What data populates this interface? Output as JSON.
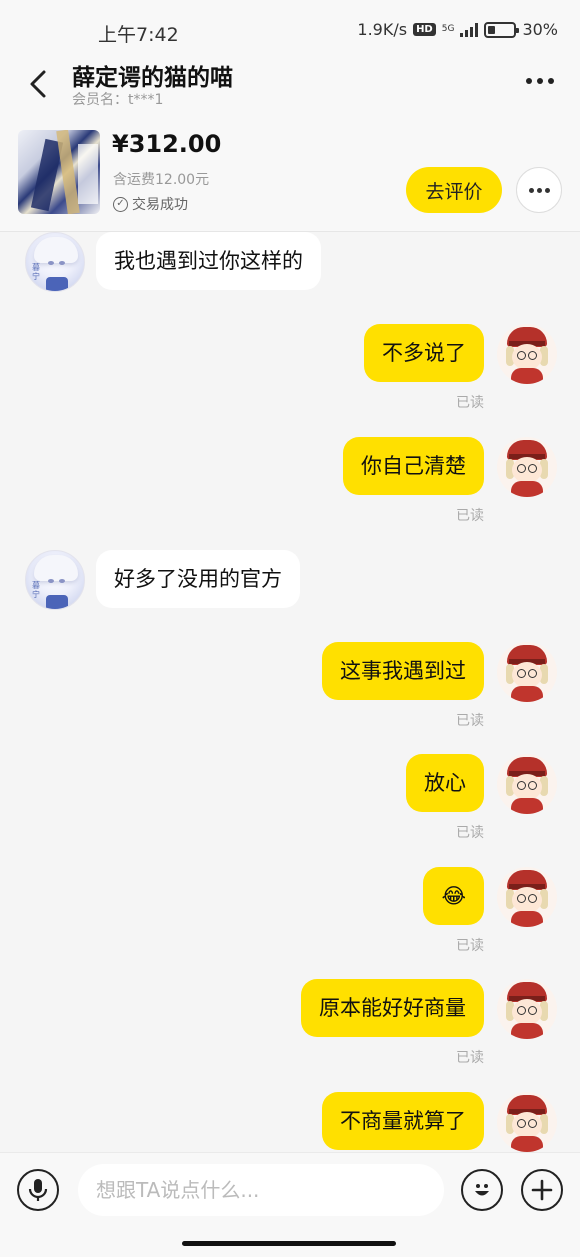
{
  "status_bar": {
    "time": "上午7:42",
    "net_speed": "1.9K/s",
    "hd": "HD",
    "network": "5G",
    "battery_label": "30%",
    "battery_level": 0.3
  },
  "header": {
    "title": "薛定谔的猫的喵",
    "member_label": "会员名：t***1"
  },
  "order": {
    "price": "¥312.00",
    "shipping": "含运费12.00元",
    "status": "交易成功",
    "review_button": "去评价"
  },
  "messages": [
    {
      "side": "left",
      "text": "我也遇到过你这样的"
    },
    {
      "side": "right",
      "text": "不多说了",
      "read": "已读"
    },
    {
      "side": "right",
      "text": "你自己清楚",
      "read": "已读"
    },
    {
      "side": "left",
      "text": "好多了没用的官方"
    },
    {
      "side": "right",
      "text": "这事我遇到过",
      "read": "已读"
    },
    {
      "side": "right",
      "text": "放心",
      "read": "已读"
    },
    {
      "side": "right",
      "text": "😂",
      "read": "已读"
    },
    {
      "side": "right",
      "text": "原本能好好商量",
      "read": "已读"
    },
    {
      "side": "right",
      "text": "不商量就算了"
    }
  ],
  "input": {
    "placeholder": "想跟TA说点什么..."
  },
  "colors": {
    "accent": "#ffe000",
    "background": "#f5f5f5"
  }
}
